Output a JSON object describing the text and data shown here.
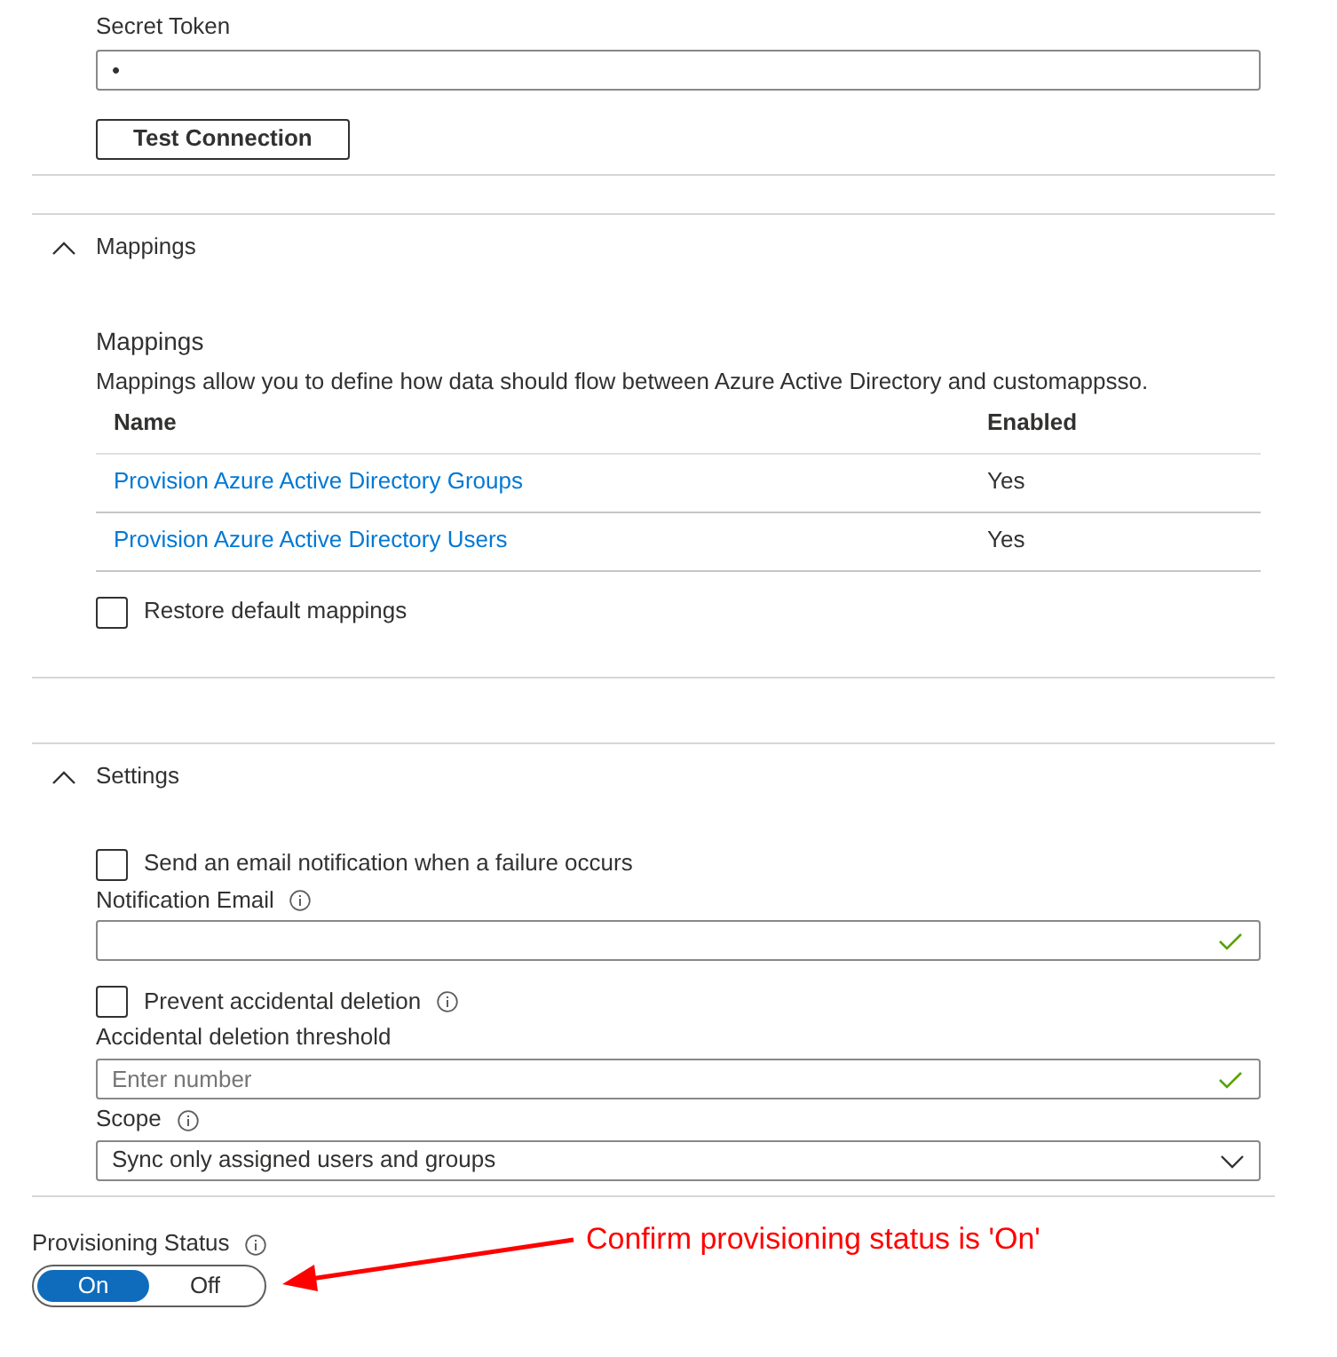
{
  "connection": {
    "secret_token": {
      "label": "Secret Token",
      "value": "•"
    },
    "test_button": "Test Connection"
  },
  "mappings": {
    "header": "Mappings",
    "expanded": true,
    "title": "Mappings",
    "description": "Mappings allow you to define how data should flow between Azure Active Directory and customappsso.",
    "columns": [
      "Name",
      "Enabled"
    ],
    "rows": [
      {
        "name": "Provision Azure Active Directory Groups",
        "enabled": "Yes"
      },
      {
        "name": "Provision Azure Active Directory Users",
        "enabled": "Yes"
      }
    ],
    "restore": {
      "label": "Restore default mappings",
      "checked": false
    }
  },
  "settings": {
    "header": "Settings",
    "expanded": true,
    "fields": [
      {
        "kind": "checkbox",
        "label": "Send an email notification when a failure occurs",
        "checked": false,
        "info": false
      },
      {
        "kind": "input",
        "label": "Notification Email",
        "info": true,
        "valid": true
      },
      {
        "kind": "checkbox",
        "label": "Prevent accidental deletion",
        "checked": false,
        "info": true
      },
      {
        "kind": "input",
        "label": "Accidental deletion threshold",
        "placeholder": "Enter number",
        "info": false,
        "valid": true
      },
      {
        "kind": "select",
        "label": "Scope",
        "info": true,
        "value": "Sync only assigned users and groups"
      }
    ]
  },
  "provisioning_status": {
    "label": "Provisioning Status",
    "info": true,
    "options": [
      {
        "label": "On",
        "selected": true
      },
      {
        "label": "Off",
        "selected": false
      }
    ]
  },
  "annotation": {
    "text": "Confirm provisioning status is 'On'"
  }
}
